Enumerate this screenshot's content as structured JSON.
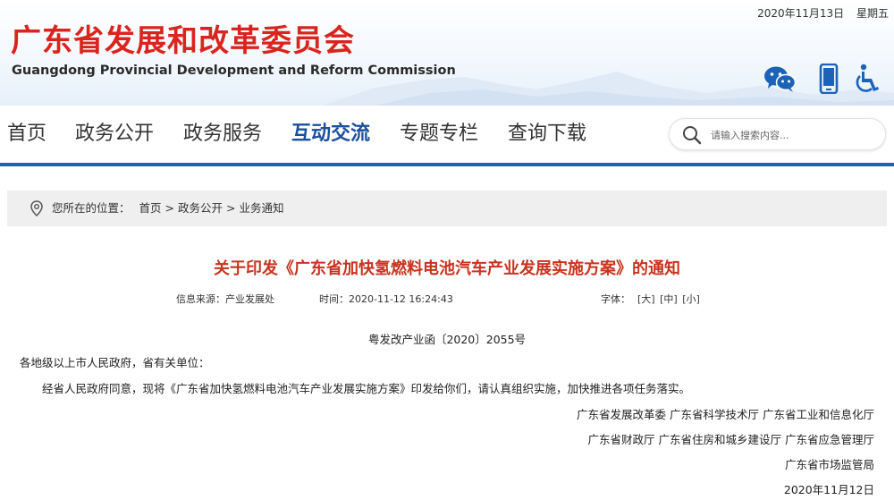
{
  "header": {
    "date": "2020年11月13日",
    "weekday": "星期五",
    "title": "广东省发展和改革委员会",
    "subtitle": "Guangdong Provincial Development and Reform Commission",
    "tools": [
      {
        "icon": "wechat-icon"
      },
      {
        "icon": "mobile-icon"
      },
      {
        "icon": "accessibility-icon"
      }
    ],
    "accent_red": "#d9251d",
    "accent_blue": "#1c63b8"
  },
  "nav": {
    "items": [
      {
        "label": "首页"
      },
      {
        "label": "政务公开"
      },
      {
        "label": "政务服务"
      },
      {
        "label": "互动交流",
        "active": true
      },
      {
        "label": "专题专栏"
      },
      {
        "label": "查询下载"
      }
    ],
    "search": {
      "placeholder": "请输入搜索内容..."
    }
  },
  "breadcrumb": {
    "label": "您所在的位置：",
    "items": [
      "首页",
      "政务公开",
      "业务通知"
    ],
    "separator": ">"
  },
  "article": {
    "title": "关于印发《广东省加快氢燃料电池汽车产业发展实施方案》的通知",
    "source_label": "信息来源：",
    "source": "产业发展处",
    "time_label": "时间：",
    "time": "2020-11-12 16:24:43",
    "font_label": "字体：",
    "font_sizes": [
      "[大]",
      "[中]",
      "[小]"
    ],
    "doc_number": "粤发改产业函〔2020〕2055号",
    "salutation": "各地级以上市人民政府，省有关单位：",
    "body": "经省人民政府同意，现将《广东省加快氢燃料电池汽车产业发展实施方案》印发给你们，请认真组织实施，加快推进各项任务落实。",
    "signatories": [
      "广东省发展改革委  广东省科学技术厅  广东省工业和信息化厅",
      "广东省财政厅  广东省住房和城乡建设厅  广东省应急管理厅",
      "广东省市场监管局"
    ],
    "sign_date": "2020年11月12日"
  }
}
